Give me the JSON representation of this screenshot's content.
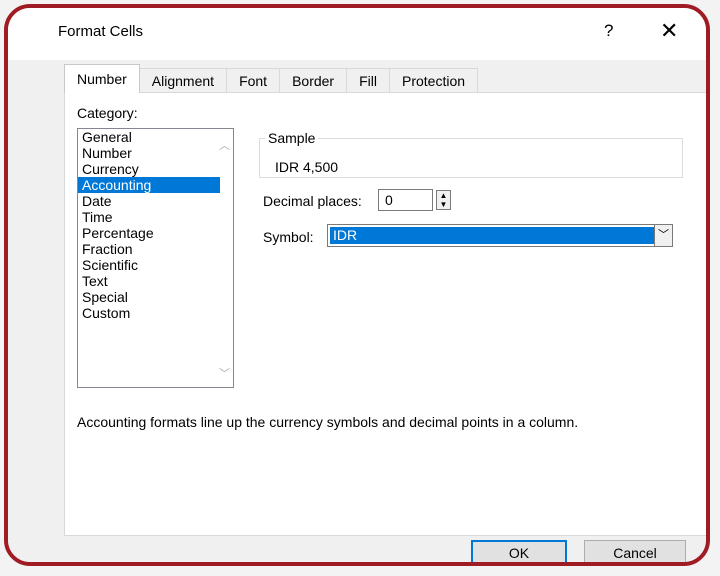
{
  "window": {
    "title": "Format Cells",
    "help_label": "?",
    "close_label": "✕"
  },
  "tabs": [
    {
      "label": "Number",
      "active": true
    },
    {
      "label": "Alignment",
      "active": false
    },
    {
      "label": "Font",
      "active": false
    },
    {
      "label": "Border",
      "active": false
    },
    {
      "label": "Fill",
      "active": false
    },
    {
      "label": "Protection",
      "active": false
    }
  ],
  "category": {
    "label": "Category:",
    "items": [
      "General",
      "Number",
      "Currency",
      "Accounting",
      "Date",
      "Time",
      "Percentage",
      "Fraction",
      "Scientific",
      "Text",
      "Special",
      "Custom"
    ],
    "selected": "Accounting"
  },
  "sample": {
    "label": "Sample",
    "value": "IDR 4,500"
  },
  "decimal_places": {
    "label": "Decimal places:",
    "value": "0"
  },
  "symbol": {
    "label": "Symbol:",
    "value": "IDR"
  },
  "description": "Accounting formats line up the currency symbols and decimal points in a column.",
  "buttons": {
    "ok": "OK",
    "cancel": "Cancel"
  },
  "colors": {
    "frame": "#a01c24",
    "selection": "#0078d7",
    "default_button_border": "#0078d7"
  }
}
